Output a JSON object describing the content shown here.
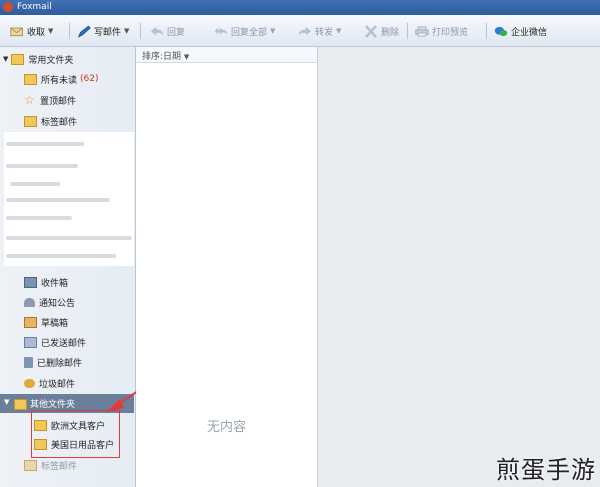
{
  "app": {
    "title": "Foxmail"
  },
  "toolbar": {
    "receive": "收取",
    "compose": "写邮件",
    "reply": "回复",
    "reply_all": "回复全部",
    "forward": "转发",
    "delete": "删除",
    "print_preview": "打印预览",
    "enterprise_wechat": "企业微信"
  },
  "sidebar": {
    "common_folders": "常用文件夹",
    "all_unread": "所有未读",
    "unread_count": "(62)",
    "pinned": "置顶邮件",
    "tagged": "标签邮件",
    "inbox": "收件箱",
    "notices": "通知公告",
    "drafts": "草稿箱",
    "sent": "已发送邮件",
    "deleted": "已删除邮件",
    "junk": "垃圾邮件",
    "other_folders": "其他文件夹",
    "sub_folder_1": "欧洲文具客户",
    "sub_folder_2": "美国日用品客户",
    "tag_mail": "标签邮件"
  },
  "list": {
    "sort_label": "排序:日期",
    "empty_text": "无内容"
  },
  "watermark": "煎蛋手游",
  "colors": {
    "title_bar": "#2e5c9c",
    "accent": "#6b7f9b",
    "highlight_box": "#e03a3a",
    "unread": "#d2331f"
  }
}
